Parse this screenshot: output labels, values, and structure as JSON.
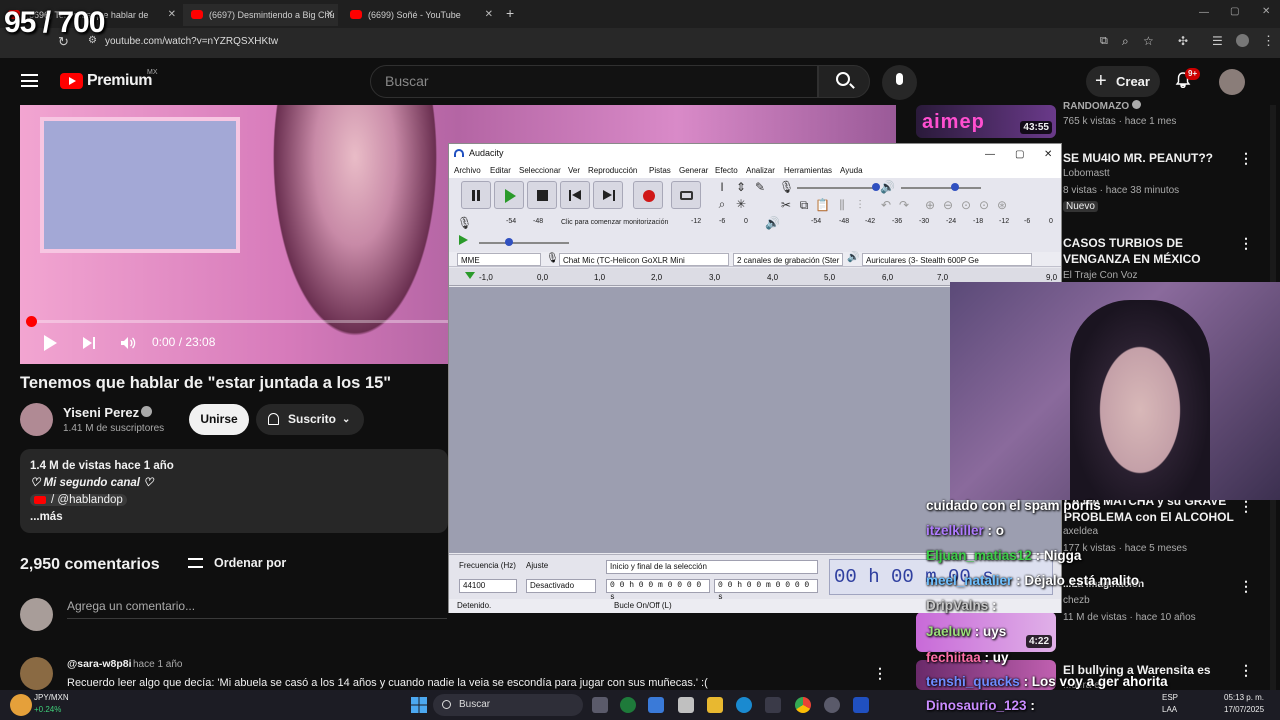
{
  "overlay": {
    "counter": "95 / 700"
  },
  "browser": {
    "tabs": [
      {
        "label": "(6696) Tenemos que hablar de"
      },
      {
        "label": "(6697) Desmintiendo a Big Chu"
      },
      {
        "label": "(6699) Soñé - YouTube"
      }
    ],
    "new_tab": "+",
    "url": "youtube.com/watch?v=nYZRQSXHKtw"
  },
  "youtube": {
    "logo": "Premium",
    "region": "MX",
    "search_placeholder": "Buscar",
    "create_label": "Crear",
    "notif_count": "9+"
  },
  "video": {
    "time": "0:00 / 23:08",
    "progress": 0.0
  },
  "info": {
    "title": "Tenemos que hablar de \"estar juntada a los 15\"",
    "channel": "Yiseni Perez",
    "subs": "1.41 M de suscriptores",
    "join": "Unirse",
    "subscribed": "Suscrito",
    "desc_views": "1.4 M de vistas  hace 1 año",
    "desc_line2": "♡ Mi segundo canal ♡",
    "desc_handle": "/ @hablandop",
    "desc_more": "...más"
  },
  "comments": {
    "count": "2,950 comentarios",
    "sort": "Ordenar por",
    "add_placeholder": "Agrega un comentario...",
    "first": {
      "user": "@sara-w8p8i",
      "ago": "hace 1 año",
      "text": "Recuerdo leer algo que decía: 'Mi abuela se casó a los 14 años y cuando nadie la veia se escondía para jugar con sus muñecas.' :("
    }
  },
  "sidebar": [
    {
      "title": "RANDOMAZO",
      "meta": "765 k vistas · hace 1 mes",
      "duration": "43:55",
      "thumb_text": "aimep"
    },
    {
      "title": "SE MU4IO MR. PEANUT??",
      "channel": "Lobomastt",
      "meta": "8 vistas · hace 38 minutos",
      "badge": "Nuevo"
    },
    {
      "title": "CASOS TURBIOS DE VENGANZA EN MÉXICO",
      "channel": "El Traje Con Voz"
    },
    {
      "title": "LA NA MATCHA y su GRAVE PROBLEMA con El ALCOHOL",
      "channel": "axeldea",
      "meta": "177 k vistas · hace 5 meses"
    },
    {
      "title": "...La Imaginación",
      "channel": "chezb",
      "meta": "11 M de vistas · hace 10 años",
      "duration": "4:22"
    },
    {
      "title": "El bullying a Warensita es",
      "meta": "...dera es"
    }
  ],
  "audacity": {
    "title": "Audacity",
    "menu": [
      "Archivo",
      "Editar",
      "Seleccionar",
      "Ver",
      "Reproducción",
      "Pistas",
      "Generar",
      "Efecto",
      "Analizar",
      "Herramientas",
      "Ayuda"
    ],
    "monitor_hint": "Clic para comenzar monitorización",
    "rec_meter_ticks": [
      "-54",
      "-48",
      "-12",
      "-6",
      "0"
    ],
    "play_meter_ticks": [
      "-54",
      "-48",
      "-42",
      "-36",
      "-30",
      "-24",
      "-18",
      "-12",
      "-6",
      "0"
    ],
    "host": "MME",
    "input_device": "Chat Mic (TC-Helicon GoXLR Mini",
    "channels": "2 canales de grabación (Ster",
    "output_device": "Auriculares (3- Stealth 600P Ge",
    "ruler": [
      "-1,0",
      "0,0",
      "1,0",
      "2,0",
      "3,0",
      "4,0",
      "5,0",
      "6,0",
      "7,0",
      "9,0"
    ],
    "freq_label": "Frecuencia (Hz)",
    "freq_value": "44100",
    "snap_label": "Ajuste",
    "snap_value": "Desactivado",
    "sel_label": "Inicio y final de la selección",
    "sel_start": "0 0 h 0 0 m 0 0 0 0 s",
    "sel_end": "0 0 h 0 0 m 0 0 0 0 s",
    "big_time": "00 h 00 m 00 s",
    "status": "Detenido.",
    "loop": "Bucle On/Off (L)"
  },
  "chat": [
    {
      "user": "",
      "text": "cuidado con el spam porfis",
      "color": "#ffffff"
    },
    {
      "user": "itzelkiller",
      "text": ": o",
      "color": "#b07cff"
    },
    {
      "user": "Eljuan_matias12",
      "text": ": Nigga",
      "color": "#3ecf4a"
    },
    {
      "user": "meel_natalier",
      "text": ": Déjalo está malito",
      "color": "#6fc0ff"
    },
    {
      "user": "DripValns",
      "text": ":",
      "color": "#c7c7c7"
    },
    {
      "user": "Jaeluw",
      "text": ": uys",
      "color": "#9be07a"
    },
    {
      "user": "fechiitaa",
      "text": ": uy",
      "color": "#ff6fa8"
    },
    {
      "user": "tenshi_quacks",
      "text": ": Los voy a ger ahorita",
      "color": "#6f8cff"
    },
    {
      "user": "Dinosaurio_123",
      "text": ":",
      "color": "#c98cff"
    }
  ],
  "taskbar": {
    "ticker": "JPY/MXN",
    "ticker_change": "+0.24%",
    "search": "Buscar",
    "lang": "ESP",
    "lang2": "LAA",
    "time": "05:13 p. m.",
    "date": "17/07/2025"
  }
}
